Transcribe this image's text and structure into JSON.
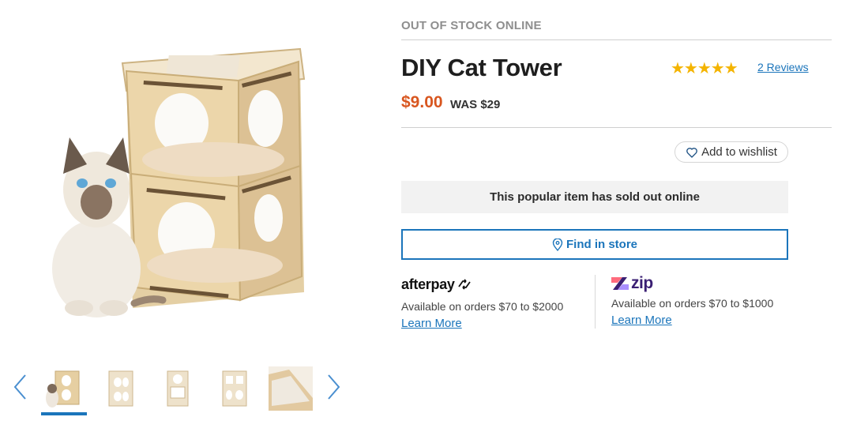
{
  "gallery": {
    "main_image_alt": "Siamese cat beside a two-tier plywood cat tower",
    "thumbnails": [
      {
        "name": "thumb-cat-with-tower",
        "active": true
      },
      {
        "name": "thumb-tower-front",
        "active": false
      },
      {
        "name": "thumb-tower-side",
        "active": false
      },
      {
        "name": "thumb-tower-angle",
        "active": false
      },
      {
        "name": "thumb-tower-top-detail",
        "active": false
      }
    ],
    "prev_icon": "chevron-left-icon",
    "next_icon": "chevron-right-icon"
  },
  "product": {
    "stock_status": "OUT OF STOCK ONLINE",
    "title": "DIY Cat Tower",
    "rating_stars": "★★★★★",
    "reviews_label": "2 Reviews",
    "price": "$9.00",
    "was_price": "WAS $29"
  },
  "actions": {
    "wishlist_label": "Add to wishlist",
    "wishlist_icon": "heart-icon",
    "sold_out_message": "This popular item has sold out online",
    "find_store_label": "Find in store",
    "find_store_icon": "map-pin-icon"
  },
  "payments": {
    "afterpay": {
      "logo_text": "afterpay",
      "text": "Available on orders $70 to $2000",
      "link": "Learn More"
    },
    "zip": {
      "logo_text": "zip",
      "text": "Available on orders $70 to $1000",
      "link": "Learn More"
    }
  },
  "colors": {
    "accent_blue": "#1b75bb",
    "price_orange": "#d8561f",
    "star_gold": "#f4b400",
    "zip_purple": "#3a1f73"
  }
}
